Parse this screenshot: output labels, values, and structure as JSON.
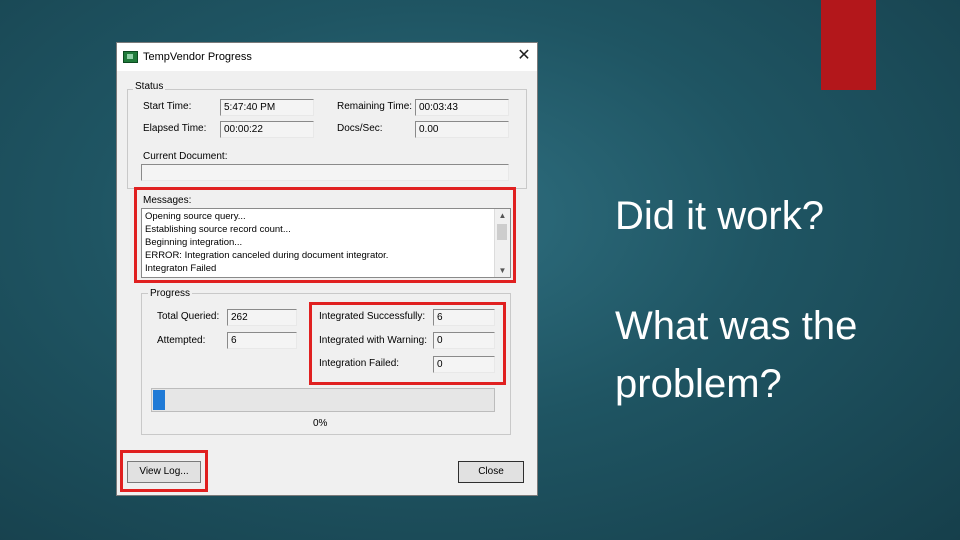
{
  "colors": {
    "accent": "#b3171b",
    "highlight": "#e02020",
    "progress_fill": "#1f7ad6",
    "background": "#1f5563"
  },
  "window": {
    "title": "TempVendor Progress",
    "icon": "app-icon",
    "close_icon": "close-icon"
  },
  "status": {
    "legend": "Status",
    "start_time_label": "Start Time:",
    "start_time_value": "5:47:40 PM",
    "remaining_time_label": "Remaining Time:",
    "remaining_time_value": "00:03:43",
    "elapsed_time_label": "Elapsed Time:",
    "elapsed_time_value": "00:00:22",
    "docs_sec_label": "Docs/Sec:",
    "docs_sec_value": "0.00",
    "current_document_label": "Current Document:",
    "current_document_value": ""
  },
  "messages": {
    "label": "Messages:",
    "lines": [
      "Opening source query...",
      "Establishing source record count...",
      "Beginning integration...",
      " ERROR: Integration canceled during document integrator.",
      "Integraton Failed"
    ]
  },
  "progress": {
    "legend": "Progress",
    "total_queried_label": "Total Queried:",
    "total_queried_value": "262",
    "attempted_label": "Attempted:",
    "attempted_value": "6",
    "integrated_successfully_label": "Integrated Successfully:",
    "integrated_successfully_value": "6",
    "integrated_with_warning_label": "Integrated with Warning:",
    "integrated_with_warning_value": "0",
    "integration_failed_label": "Integration Failed:",
    "integration_failed_value": "0",
    "percent_text": "0%",
    "fraction": 0.0
  },
  "buttons": {
    "view_log": "View Log...",
    "close": "Close"
  },
  "slide": {
    "question1": "Did it work?",
    "question2_line1": "What was the",
    "question2_line2": "problem?"
  }
}
